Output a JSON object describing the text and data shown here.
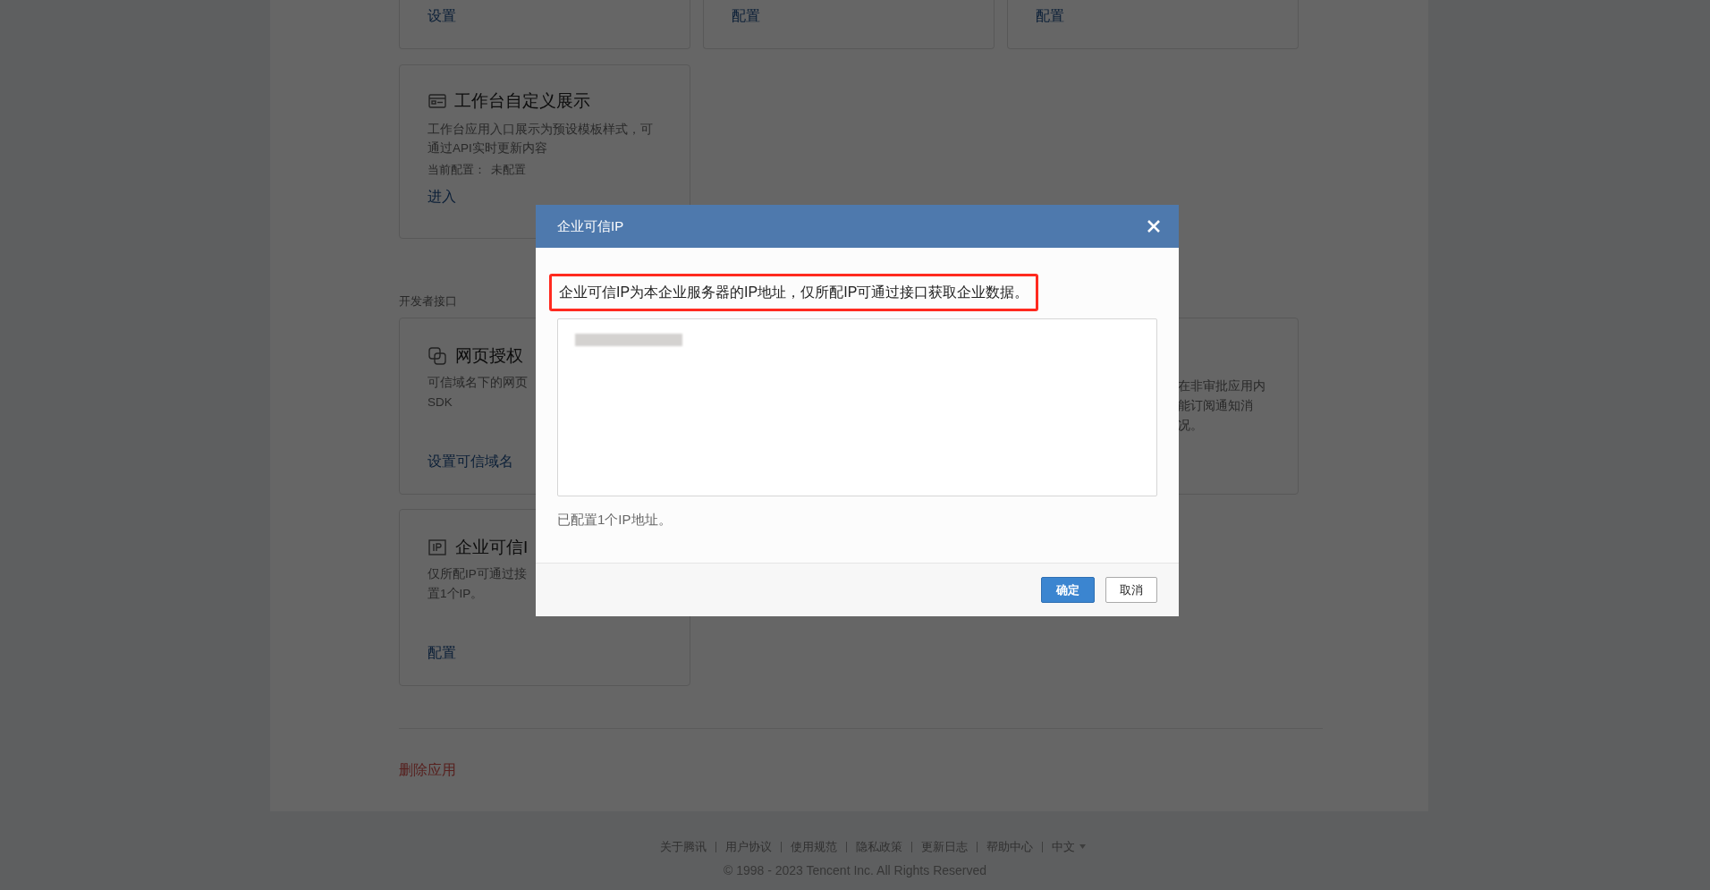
{
  "page": {
    "top_cards": [
      {
        "action": "设置"
      },
      {
        "action": "配置"
      },
      {
        "action": "配置"
      }
    ],
    "workbench_card": {
      "title": "工作台自定义展示",
      "description": "工作台应用入口展示为预设模板样式，可通过API实时更新内容",
      "config_label": "当前配置：",
      "config_value": "未配置",
      "action": "进入"
    },
    "section_title": "开发者接口",
    "dev_cards": [
      {
        "kind": "pages",
        "title": "网页授权",
        "description_lines": [
          "可信域名下的网页",
          "SDK"
        ],
        "action": "设置可信域名"
      },
      {
        "kind": "ip",
        "title": "企业可信I",
        "description_lines": [
          "仅所配IP可通过接",
          "置1个IP。"
        ],
        "action": "配置"
      }
    ],
    "right_card": {
      "description_lines": [
        "在非审批应用内",
        "能订阅通知消",
        "况。"
      ]
    },
    "delete_action": "删除应用"
  },
  "dialog": {
    "title": "企业可信IP",
    "notice": "企业可信IP为本企业服务器的IP地址，仅所配IP可通过接口获取企业数据。",
    "count_text": "已配置1个IP地址。",
    "buttons": [
      {
        "label": "确定",
        "kind": "primary"
      },
      {
        "label": "取消",
        "kind": "default"
      }
    ]
  },
  "footer": {
    "links": [
      "关于腾讯",
      "用户协议",
      "使用规范",
      "隐私政策",
      "更新日志",
      "帮助中心"
    ],
    "language": "中文",
    "copyright": "© 1998 - 2023 Tencent Inc. All Rights Reserved"
  }
}
